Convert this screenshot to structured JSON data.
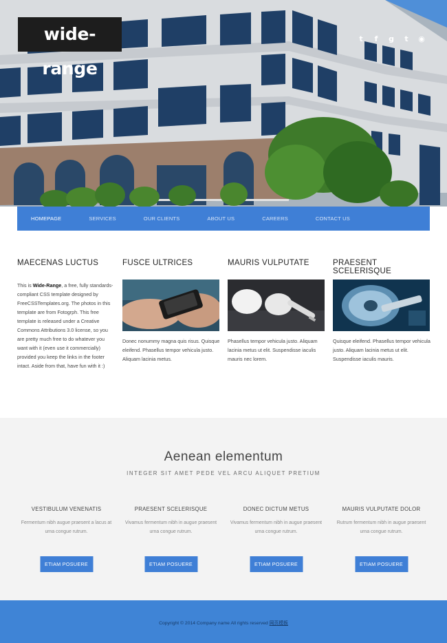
{
  "header": {
    "logo": "wide-range",
    "social_icons": [
      "twitter-icon",
      "facebook-icon",
      "google-plus-icon",
      "tumblr-icon",
      "rss-icon"
    ]
  },
  "nav": {
    "items": [
      {
        "label": "Homepage",
        "active": true
      },
      {
        "label": "Services",
        "active": false
      },
      {
        "label": "Our Clients",
        "active": false
      },
      {
        "label": "About Us",
        "active": false
      },
      {
        "label": "Careers",
        "active": false
      },
      {
        "label": "Contact Us",
        "active": false
      }
    ]
  },
  "features": {
    "intro": {
      "title": "Maecenas luctus",
      "text_before": "This is ",
      "text_bold": "Wide-Range",
      "text_after": ", a free, fully standards-compliant CSS template designed by FreeCSSTemplates.org. The photos in this template are from Fotogrph. This free template is released under a Creative Commons Attributions 3.0 license, so you are pretty much free to do whatever you want with it (even use it commercially) provided you keep the links in the footer intact. Aside from that, have fun with it :)"
    },
    "columns": [
      {
        "title": "Fusce ultrices",
        "text": "Donec nonummy magna quis risus. Quisque eleifend. Phasellus tempor vehicula justo. Aliquam lacinia metus."
      },
      {
        "title": "Mauris vulputate",
        "text": "Phasellus tempor vehicula justo. Aliquam lacinia metus ut elit. Suspendisse iaculis mauris nec lorem."
      },
      {
        "title": "Praesent scelerisque",
        "text": "Quisque eleifend. Phasellus tempor vehicula justo. Aliquam lacinia metus ut elit. Suspendisse iaculis mauris."
      }
    ]
  },
  "band": {
    "title": "Aenean elementum",
    "subtitle": "Integer sit amet pede vel arcu aliquet pretium",
    "boxes": [
      {
        "title": "Vestibulum venenatis",
        "text": "Fermentum nibh augue praesent a lacus at urna congue rutrum.",
        "button": "Etiam posuere"
      },
      {
        "title": "Praesent scelerisque",
        "text": "Vivamus fermentum nibh in augue praesent urna congue rutrum.",
        "button": "Etiam posuere"
      },
      {
        "title": "Donec dictum metus",
        "text": "Vivamus fermentum nibh in augue praesent urna congue rutrum.",
        "button": "Etiam posuere"
      },
      {
        "title": "Mauris vulputate dolor",
        "text": "Rutrum fermentum nibh in augue praesent urna congue rutrum.",
        "button": "Etiam posuere"
      }
    ]
  },
  "footer": {
    "copyright": "Copyright © 2014 Company name All rights reserved ",
    "link": "网页模板"
  },
  "colors": {
    "accent_blue": "#3f7fd6",
    "footer_blue": "#3f84d6",
    "band_grey": "#f3f3f3",
    "logo_bg": "#1d1d1d"
  }
}
